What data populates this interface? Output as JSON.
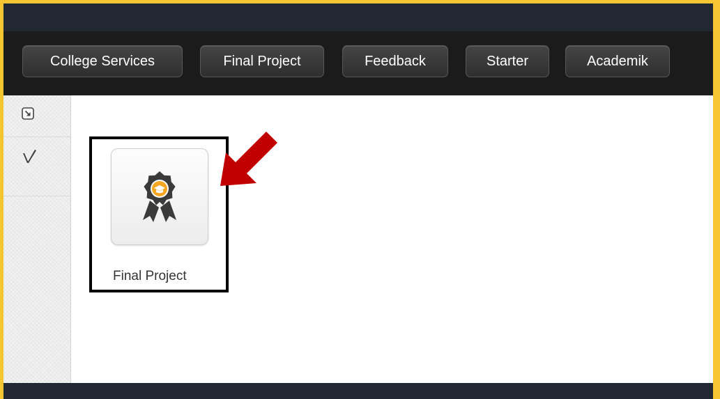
{
  "nav": {
    "tabs": [
      {
        "label": "College Services"
      },
      {
        "label": "Final Project"
      },
      {
        "label": "Feedback"
      },
      {
        "label": "Starter"
      },
      {
        "label": "Academik"
      }
    ]
  },
  "sidebar": {
    "items": [
      {
        "icon": "resize-icon"
      },
      {
        "icon": "checkmark-logo-icon"
      }
    ]
  },
  "main": {
    "tile": {
      "label": "Final Project",
      "icon": "award-ribbon-icon"
    }
  },
  "annotation": {
    "arrow_color": "#C00000",
    "highlight_color": "#000000"
  },
  "colors": {
    "border": "#F7C532",
    "navbar": "#1b1b1b",
    "accent_orange": "#F5A623"
  }
}
